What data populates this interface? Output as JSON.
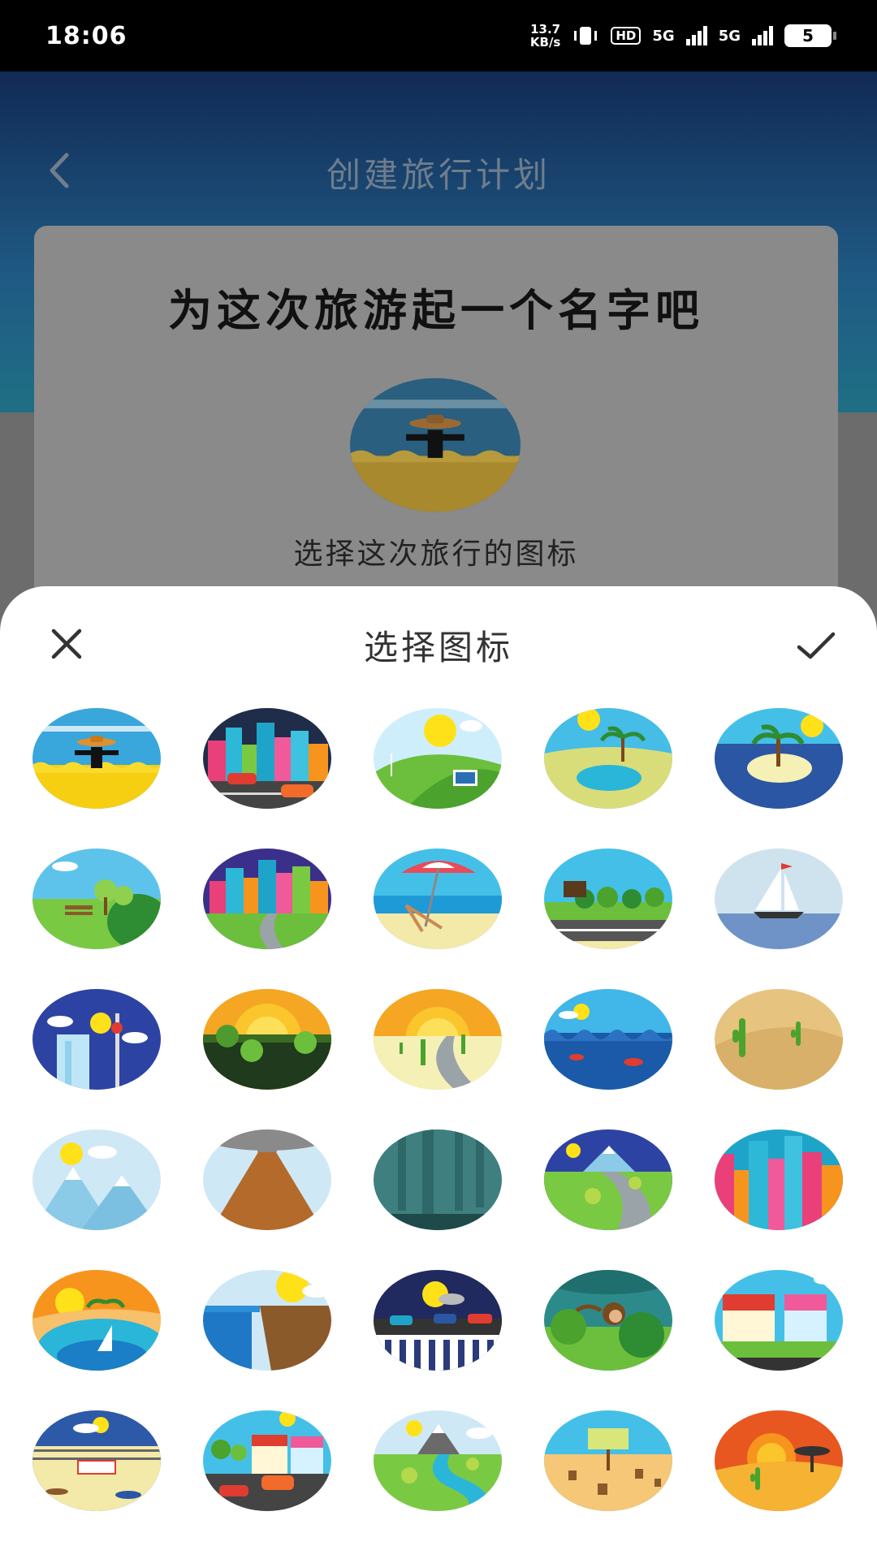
{
  "status_bar": {
    "time": "18:06",
    "net_speed_value": "13.7",
    "net_speed_unit": "KB/s",
    "hd_label": "HD",
    "sim1_label": "5G",
    "sim2_label": "5G",
    "battery_level": "5"
  },
  "header": {
    "back_icon": "chevron-left-icon",
    "title": "创建旅行计划"
  },
  "name_card": {
    "heading": "为这次旅游起一个名字吧",
    "selected_icon": "scarecrow-field",
    "icon_caption": "选择这次旅行的图标"
  },
  "icon_sheet": {
    "title": "选择图标",
    "close_icon": "close-icon",
    "confirm_icon": "check-icon",
    "icons": [
      "scarecrow-field",
      "city-traffic",
      "solar-panel-hills",
      "oasis-palm",
      "palm-island",
      "park-bench",
      "city-park-path",
      "beach-chair",
      "highway-86",
      "sailboat",
      "tv-tower-city",
      "sunset-forest",
      "desert-road",
      "sea-fish",
      "desert-cactus",
      "snow-mountains",
      "volcano",
      "dark-forest",
      "mountain-road",
      "colorful-city",
      "tropical-lagoon",
      "waterfall-cliff",
      "night-traffic",
      "monkey-jungle",
      "food-stalls",
      "warzone-beach",
      "street-shops",
      "river-mountains",
      "save-the-trees",
      "savanna-sunset"
    ]
  },
  "colors": {
    "sheet_background": "#ffffff",
    "header_gradient_top": "#112a55",
    "header_gradient_bottom": "#1f6f85",
    "overlay_gray": "#6c6c6c"
  }
}
